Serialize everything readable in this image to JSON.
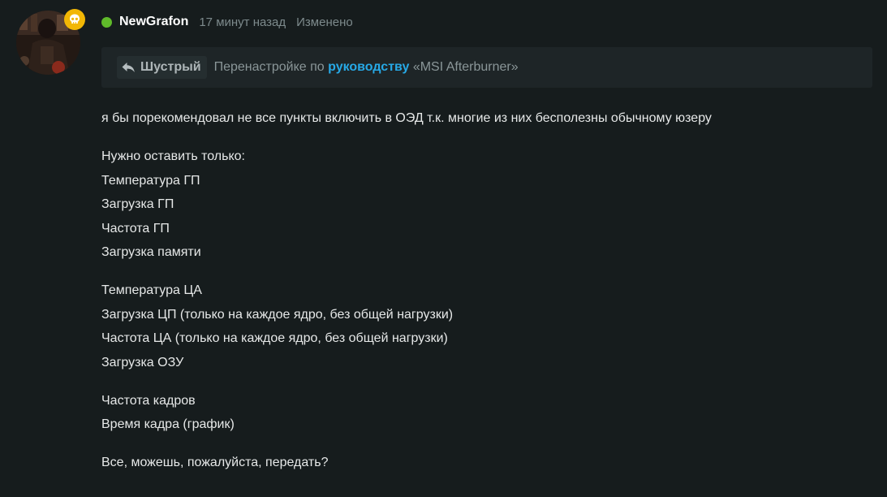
{
  "author": {
    "name": "NewGrafon",
    "status_color": "#5fba2a",
    "badge_icon": "skull-icon",
    "badge_color": "#f2b705"
  },
  "meta": {
    "time": "17 минут назад",
    "edited": "Изменено"
  },
  "reply": {
    "icon": "reply-arrow-icon",
    "author": "Шустрый",
    "quote_before": "Перенастройке по",
    "quote_link": "руководству",
    "quote_after": "«MSI Afterburner»",
    "link_color": "#27a9e6"
  },
  "body": {
    "intro": "я бы порекомендовал не все пункты включить в ОЭД т.к. многие из них бесполезны обычному юзеру",
    "gpu_block": [
      "Нужно оставить только:",
      "Температура ГП",
      "Загрузка ГП",
      "Частота ГП",
      "Загрузка памяти"
    ],
    "cpu_block": [
      "Температура ЦА",
      "Загрузка ЦП (только на каждое ядро, без общей нагрузки)",
      "Частота ЦА (только на каждое ядро, без общей нагрузки)",
      "Загрузка ОЗУ"
    ],
    "frame_block": [
      "Частота кадров",
      "Время кадра (график)"
    ],
    "closing": "Все, можешь, пожалуйста, передать?"
  }
}
